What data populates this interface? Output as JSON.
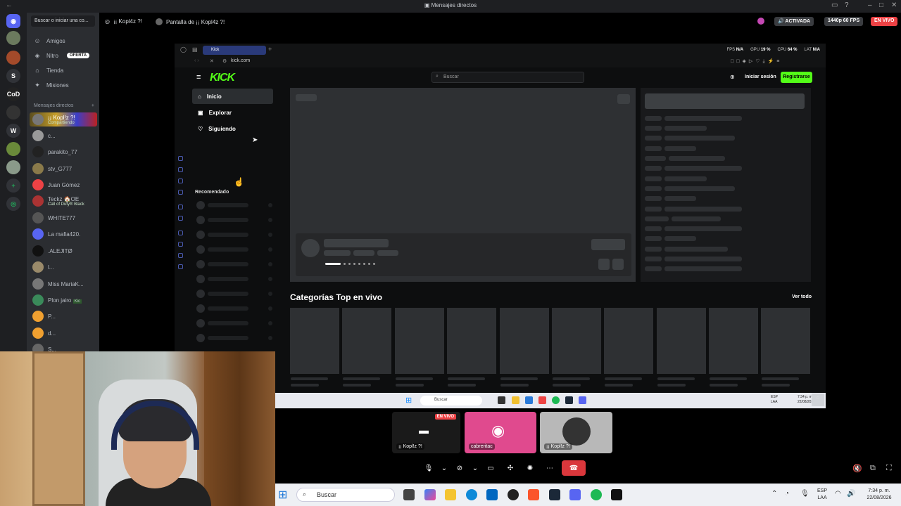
{
  "window": {
    "title": "Mensajes directos"
  },
  "dm_sidebar": {
    "search_placeholder": "Buscar o iniciar una co...",
    "nav": [
      {
        "label": "Amigos",
        "icon": "friends-icon"
      },
      {
        "label": "Nitro",
        "icon": "nitro-icon",
        "badge": "OFERTA"
      },
      {
        "label": "Tienda",
        "icon": "shop-icon"
      },
      {
        "label": "Misiones",
        "icon": "quests-icon"
      }
    ],
    "header": "Mensajes directos",
    "items": [
      {
        "name": "¡¡ Kopl!z ?!",
        "status": "Compartiendo"
      },
      {
        "name": "c..."
      },
      {
        "name": "parakito_77"
      },
      {
        "name": "stv_G777"
      },
      {
        "name": "Juan Gómez"
      },
      {
        "name": "Teckz 🏠OE",
        "status": "Call of Duty® Black"
      },
      {
        "name": "WHITE777"
      },
      {
        "name": "La mafia420."
      },
      {
        "name": ".ALEJITØ"
      },
      {
        "name": "l..."
      },
      {
        "name": "Miss MariaK..."
      },
      {
        "name": "Plon jairo",
        "tag": "Kic"
      },
      {
        "name": "P..."
      },
      {
        "name": "d..."
      },
      {
        "name": "S..."
      }
    ]
  },
  "stream_header": {
    "user": "¡¡ Kopl4z ?!",
    "screen": "Pantalla de ¡¡ Kopl4z ?!",
    "activated": "ACTIVADA",
    "quality": "1440p 60 FPS",
    "live": "EN VIVO"
  },
  "browser": {
    "tab": "Kick",
    "url": "kick.com",
    "stats": {
      "fps_label": "FPS",
      "fps": "N/A",
      "gpu_label": "GPU",
      "gpu": "19 %",
      "cpu_label": "CPU",
      "cpu": "64 %",
      "lat_label": "LAT",
      "lat": "N/A"
    }
  },
  "kick": {
    "logo": "KICK",
    "search_placeholder": "Buscar",
    "login": "Iniciar sesión",
    "register": "Registrarse",
    "nav": [
      {
        "label": "Inicio",
        "icon": "home-icon"
      },
      {
        "label": "Explorar",
        "icon": "explore-icon"
      },
      {
        "label": "Siguiendo",
        "icon": "heart-icon"
      }
    ],
    "recommended": "Recomendado",
    "categories_title": "Categorías Top en vivo",
    "see_all": "Ver todo"
  },
  "inner_taskbar": {
    "search": "Buscar",
    "lang": "ESP\nLAA",
    "time": "7:34 p. m.",
    "date": "22/08/2026"
  },
  "call": {
    "tiles": [
      {
        "label": "¡¡ Kopl!z ?!",
        "live": "EN VIVO"
      },
      {
        "label": "cabreritac"
      },
      {
        "label": "¡¡ Kopl!z ?!"
      }
    ]
  },
  "taskbar": {
    "search": "Buscar",
    "lang_top": "ESP",
    "lang_bottom": "LAA",
    "time": "7:34 p. m.",
    "date": "22/08/2026"
  },
  "colors": {
    "kick_green": "#53fc18",
    "discord_blurple": "#5865f2",
    "live_red": "#ed4245"
  }
}
